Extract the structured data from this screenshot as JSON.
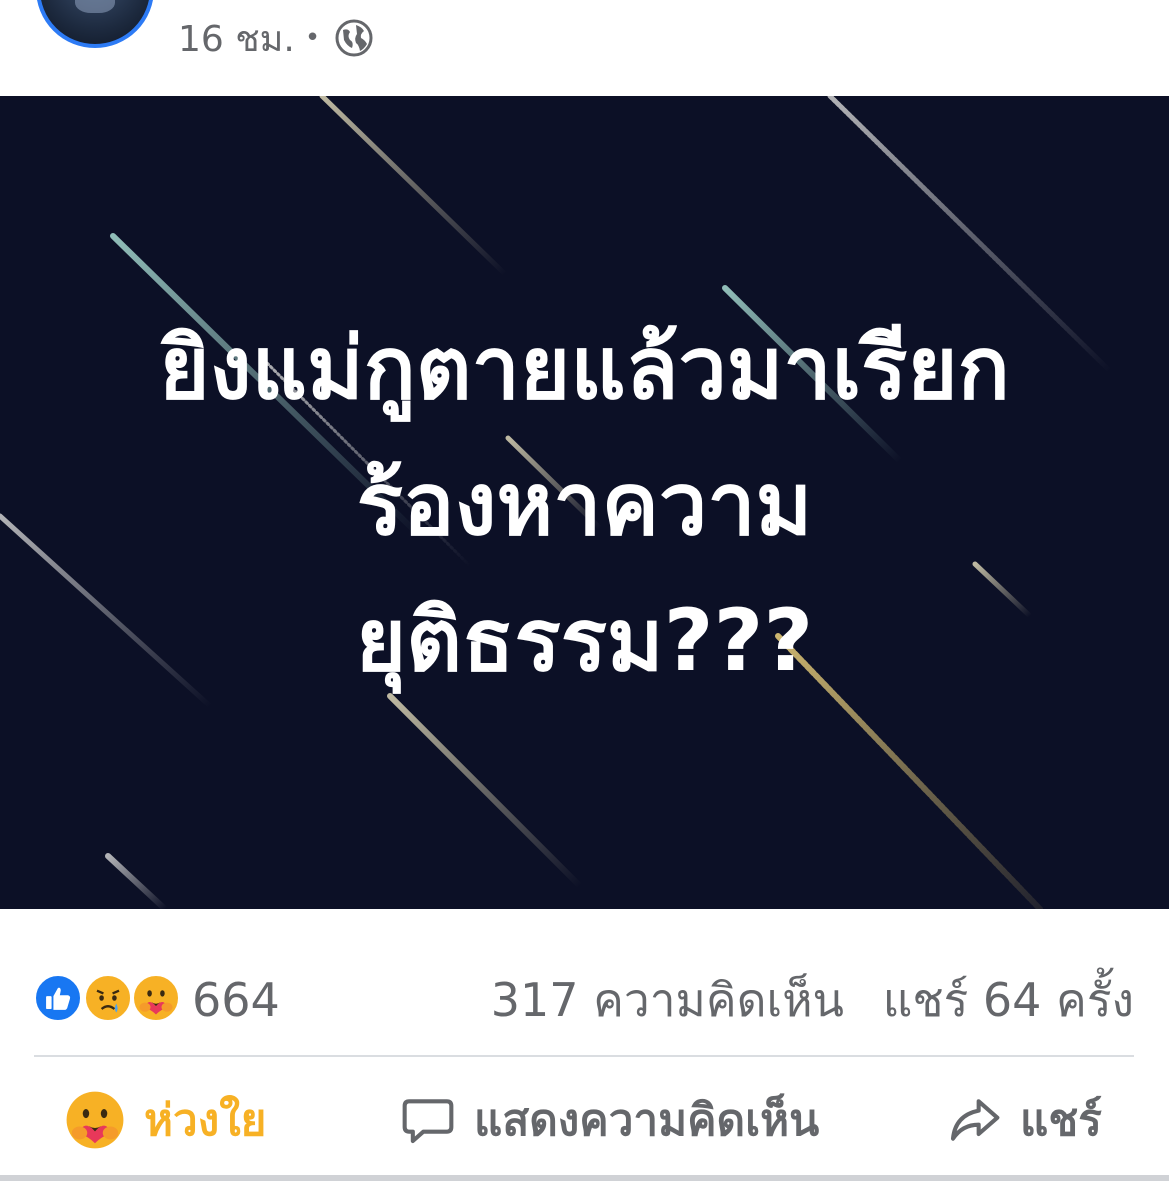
{
  "header": {
    "time_label": "16 ชม.",
    "separator": "•",
    "privacy_icon": "globe-icon"
  },
  "post": {
    "text_lines": [
      "ยิงแม่กูตายแล้วมาเรียก",
      "ร้องหาความ",
      "ยุติธรรม???"
    ],
    "background_color": "#0c1026"
  },
  "stats": {
    "reaction_icons": [
      "like-icon",
      "sad-icon",
      "care-icon"
    ],
    "reaction_count": "664",
    "comments": "317 ความคิดเห็น",
    "shares": "แชร์ 64 ครั้ง"
  },
  "actions": {
    "care_label": "ห่วงใย",
    "comment_label": "แสดงความคิดเห็น",
    "share_label": "แชร์"
  },
  "colors": {
    "accent_blue": "#1877f2",
    "care_yellow": "#f7b125",
    "secondary_text": "#65676b"
  }
}
